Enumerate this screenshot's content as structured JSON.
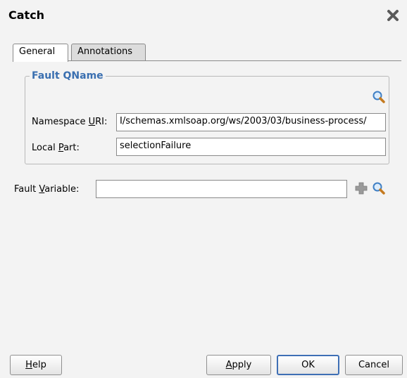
{
  "dialog": {
    "title": "Catch"
  },
  "tabs": [
    {
      "label": "General",
      "selected": true
    },
    {
      "label": "Annotations",
      "selected": false
    }
  ],
  "fault_qname": {
    "group_title": "Fault QName",
    "namespace_label": {
      "before": "Namespace ",
      "mnemonic": "U",
      "after": "RI:"
    },
    "namespace_value": "I/schemas.xmlsoap.org/ws/2003/03/business-process/",
    "local_part_label": {
      "before": "Local ",
      "mnemonic": "P",
      "after": "art:"
    },
    "local_part_value": "selectionFailure"
  },
  "fault_variable": {
    "label": {
      "before": "Fault ",
      "mnemonic": "V",
      "after": "ariable:"
    },
    "value": ""
  },
  "buttons": {
    "help": {
      "mnemonic": "H",
      "after": "elp"
    },
    "apply": {
      "mnemonic": "A",
      "after": "pply"
    },
    "ok": "OK",
    "cancel": "Cancel"
  },
  "colors": {
    "accent": "#3a6fb0",
    "add_icon": "#9a9a9a",
    "search_icon": "#3f7fc4"
  }
}
